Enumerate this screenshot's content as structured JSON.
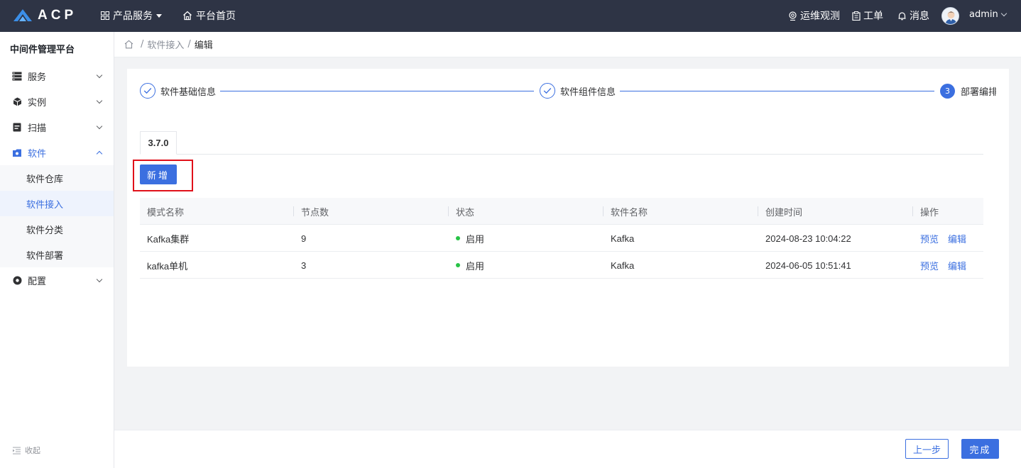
{
  "app": {
    "logo_text": "ACP"
  },
  "topbar": {
    "product_services": "产品服务",
    "home": "平台首页",
    "ops": "运维观测",
    "tickets": "工单",
    "messages": "消息",
    "user": "admin"
  },
  "sidebar": {
    "title": "中间件管理平台",
    "menu": {
      "service": "服务",
      "instance": "实例",
      "scan": "扫描",
      "software": "软件",
      "config": "配置"
    },
    "software_sub": {
      "repo": "软件仓库",
      "access": "软件接入",
      "category": "软件分类",
      "deploy": "软件部署"
    },
    "collapse": "收起"
  },
  "breadcrumb": {
    "sep": "/",
    "parent": "软件接入",
    "current": "编辑"
  },
  "steps": {
    "step1": "软件基础信息",
    "step2": "软件组件信息",
    "step3_num": "3",
    "step3": "部署编排"
  },
  "tabs": {
    "active": "3.7.0"
  },
  "toolbar": {
    "add_label": "新增"
  },
  "table": {
    "headers": [
      "模式名称",
      "节点数",
      "状态",
      "软件名称",
      "创建时间",
      "操作"
    ],
    "rows": [
      {
        "mode": "Kafka集群",
        "nodes": "9",
        "status": "启用",
        "software": "Kafka",
        "created": "2024-08-23 10:04:22",
        "preview": "预览",
        "edit": "编辑"
      },
      {
        "mode": "kafka单机",
        "nodes": "3",
        "status": "启用",
        "software": "Kafka",
        "created": "2024-06-05 10:51:41",
        "preview": "预览",
        "edit": "编辑"
      }
    ]
  },
  "footer": {
    "prev": "上一步",
    "done": "完成"
  },
  "colors": {
    "primary": "#3b6fe0",
    "topbar": "#2e3445",
    "status_green": "#27c346",
    "highlight": "#e0101a"
  }
}
